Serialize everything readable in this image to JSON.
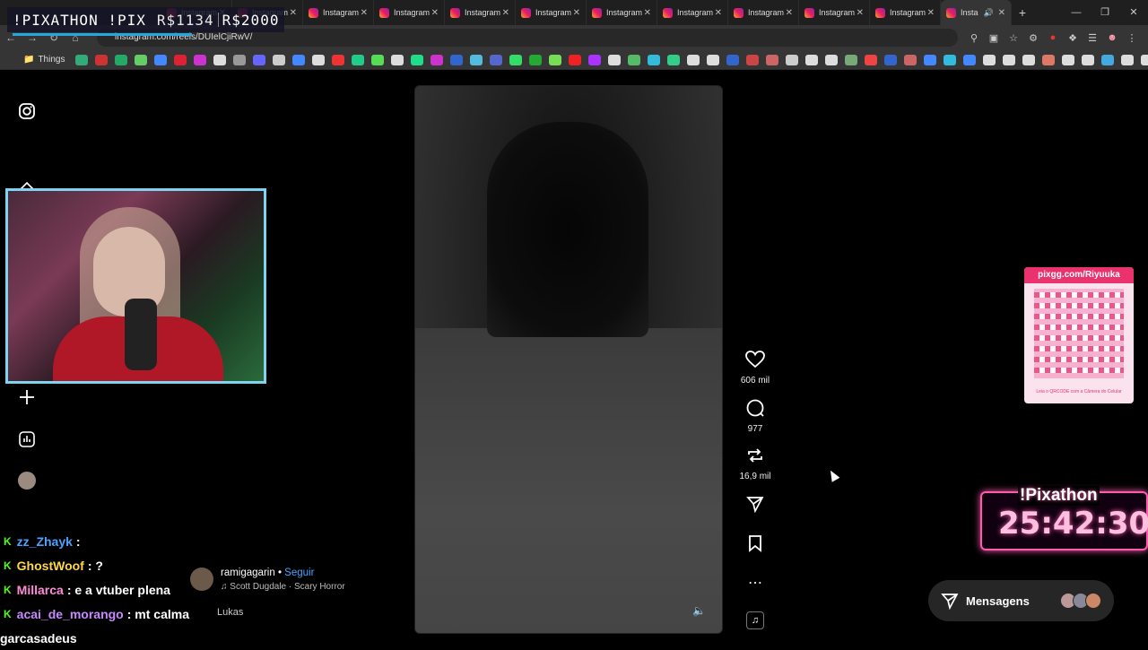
{
  "browser": {
    "tabs": [
      {
        "label": "Instagram",
        "active": false
      },
      {
        "label": "Instagram",
        "active": false
      },
      {
        "label": "Instagram",
        "active": false
      },
      {
        "label": "Instagram",
        "active": false
      },
      {
        "label": "Instagram",
        "active": false
      },
      {
        "label": "Instagram",
        "active": false
      },
      {
        "label": "Instagram",
        "active": false
      },
      {
        "label": "Instagram",
        "active": false
      },
      {
        "label": "Instagram",
        "active": false
      },
      {
        "label": "Instagram",
        "active": false
      },
      {
        "label": "Instagram",
        "active": false
      },
      {
        "label": "Insta",
        "active": true
      }
    ],
    "url": "instagram.com/reels/DUIelCjiRwV/",
    "bookmarks_folder": "Things"
  },
  "overlay": {
    "pixathon_banner": "!PIXATHON !PIX",
    "amount_raised": "R$1134",
    "amount_goal": "R$2000",
    "qr_header": "pixgg.com/Riyuuka",
    "qr_footer": "Leia o QRCODE com a Câmera do Celular",
    "timer_title": "!Pixathon",
    "timer_value": "25:42:30"
  },
  "reel": {
    "likes": "606 mil",
    "comments": "977",
    "reposts": "16,9 mil",
    "author": "ramigagarin",
    "separator": "•",
    "follow_label": "Seguir",
    "song": "Scott Dugdale · Scary Horror",
    "caption_fragment": "Lukas"
  },
  "chat": [
    {
      "user": "zz_Zhayk",
      "message": ":",
      "user_color": "#4aa3ff"
    },
    {
      "user": "GhostWoof",
      "message": ": ?",
      "user_color": "#ffd84a"
    },
    {
      "user": "Millarca",
      "message": ": e a vtuber plena",
      "user_color": "#ff8ad8"
    },
    {
      "user": "acai_de_morango",
      "message": ": mt calma",
      "user_color": "#c68aff"
    },
    {
      "user": "garcasadeus",
      "message": "",
      "user_color": "#ffffff"
    }
  ],
  "messages_button": {
    "label": "Mensagens"
  },
  "colors": {
    "kick_green": "#53fc18",
    "instagram_blue": "#4aa3ff",
    "timer_pink": "#ff5ab0"
  }
}
